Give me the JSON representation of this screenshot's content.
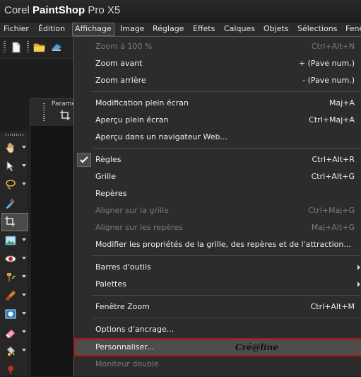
{
  "app": {
    "title_prefix": "Corel ",
    "title_bold": "PaintShop",
    "title_suffix": " Pro X5"
  },
  "menubar": [
    {
      "label": "Fichier"
    },
    {
      "label": "Édition"
    },
    {
      "label": "Affichage"
    },
    {
      "label": "Image"
    },
    {
      "label": "Réglage"
    },
    {
      "label": "Effets"
    },
    {
      "label": "Calques"
    },
    {
      "label": "Objets"
    },
    {
      "label": "Sélections"
    },
    {
      "label": "Fenê"
    }
  ],
  "params_panel": {
    "label": "Paramè"
  },
  "menu": {
    "items": [
      {
        "label": "Zoom à 100 %",
        "shortcut": "Ctrl+Alt+N",
        "disabled": true
      },
      {
        "label": "Zoom avant",
        "shortcut": "+ (Pave num.)"
      },
      {
        "label": "Zoom arrière",
        "shortcut": "- (Pave num.)"
      },
      {
        "label": "Modification plein écran",
        "shortcut": "Maj+A"
      },
      {
        "label": "Aperçu plein écran",
        "shortcut": "Ctrl+Maj+A"
      },
      {
        "label": "Aperçu dans un navigateur Web...",
        "shortcut": ""
      },
      {
        "label": "Règles",
        "shortcut": "Ctrl+Alt+R",
        "checked": true
      },
      {
        "label": "Grille",
        "shortcut": "Ctrl+Alt+G"
      },
      {
        "label": "Repères",
        "shortcut": ""
      },
      {
        "label": "Aligner sur la grille",
        "shortcut": "Ctrl+Maj+G",
        "disabled": true
      },
      {
        "label": "Aligner sur les repères",
        "shortcut": "Maj+Alt+G",
        "disabled": true
      },
      {
        "label": "Modifier les propriétés de la grille, des repères et de l'attraction...",
        "shortcut": ""
      },
      {
        "label": "Barres d'outils",
        "shortcut": "",
        "submenu": true
      },
      {
        "label": "Palettes",
        "shortcut": "",
        "submenu": true
      },
      {
        "label": "Fenêtre Zoom",
        "shortcut": "Ctrl+Alt+M"
      },
      {
        "label": "Options d'ancrage...",
        "shortcut": ""
      },
      {
        "label": "Personnaliser...",
        "shortcut": "",
        "highlighted": true
      },
      {
        "label": "Moniteur double",
        "shortcut": "",
        "disabled": true
      }
    ],
    "watermark": "Cré@line"
  },
  "colors": {
    "menu_bg": "#2c2c2c",
    "highlight_border": "#b01818",
    "disabled_text": "#7b7b7b"
  }
}
